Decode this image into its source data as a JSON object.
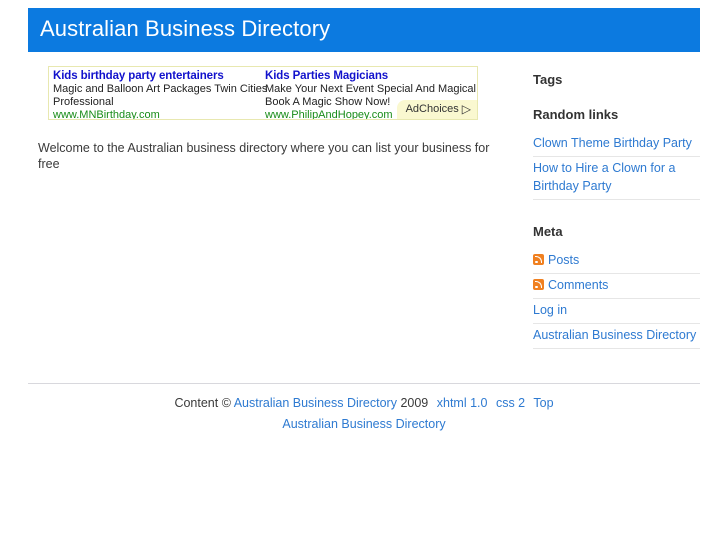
{
  "header": {
    "title": "Australian Business Directory",
    "background_color": "#0c7ae0",
    "text_color": "#ffffff"
  },
  "ads": {
    "adchoices_label": "AdChoices",
    "adchoices_icon": "triangle-right-icon",
    "units": [
      {
        "title": "Kids birthday party entertainers",
        "line1": "Magic and Balloon Art Packages Twin Cities",
        "line2": "Professional",
        "url": "www.MNBirthday.com"
      },
      {
        "title": "Kids Parties Magicians",
        "line1": "Make Your Next Event Special And Magical.",
        "line2": "Book A Magic Show Now!",
        "url": "www.PhilipAndHopey.com"
      }
    ]
  },
  "main": {
    "welcome": "Welcome to the Australian business directory where you can list your business for free"
  },
  "sidebar": {
    "tags_heading": "Tags",
    "random_links_heading": "Random links",
    "random_links": [
      "Clown Theme Birthday Party",
      "How to Hire a Clown for a Birthday Party"
    ],
    "meta_heading": "Meta",
    "meta_links": [
      {
        "label": "Posts",
        "icon": "rss-icon"
      },
      {
        "label": "Comments",
        "icon": "rss-icon"
      },
      {
        "label": "Log in",
        "icon": null
      },
      {
        "label": "Australian Business Directory",
        "icon": null
      }
    ],
    "link_color": "#2e7ad1"
  },
  "footer": {
    "content_prefix": "Content ©",
    "site_link": "Australian Business Directory",
    "year": "2009",
    "xhtml_link": "xhtml 1.0",
    "css_link": "css 2",
    "top_link": "Top",
    "bottom_link": "Australian Business Directory"
  }
}
